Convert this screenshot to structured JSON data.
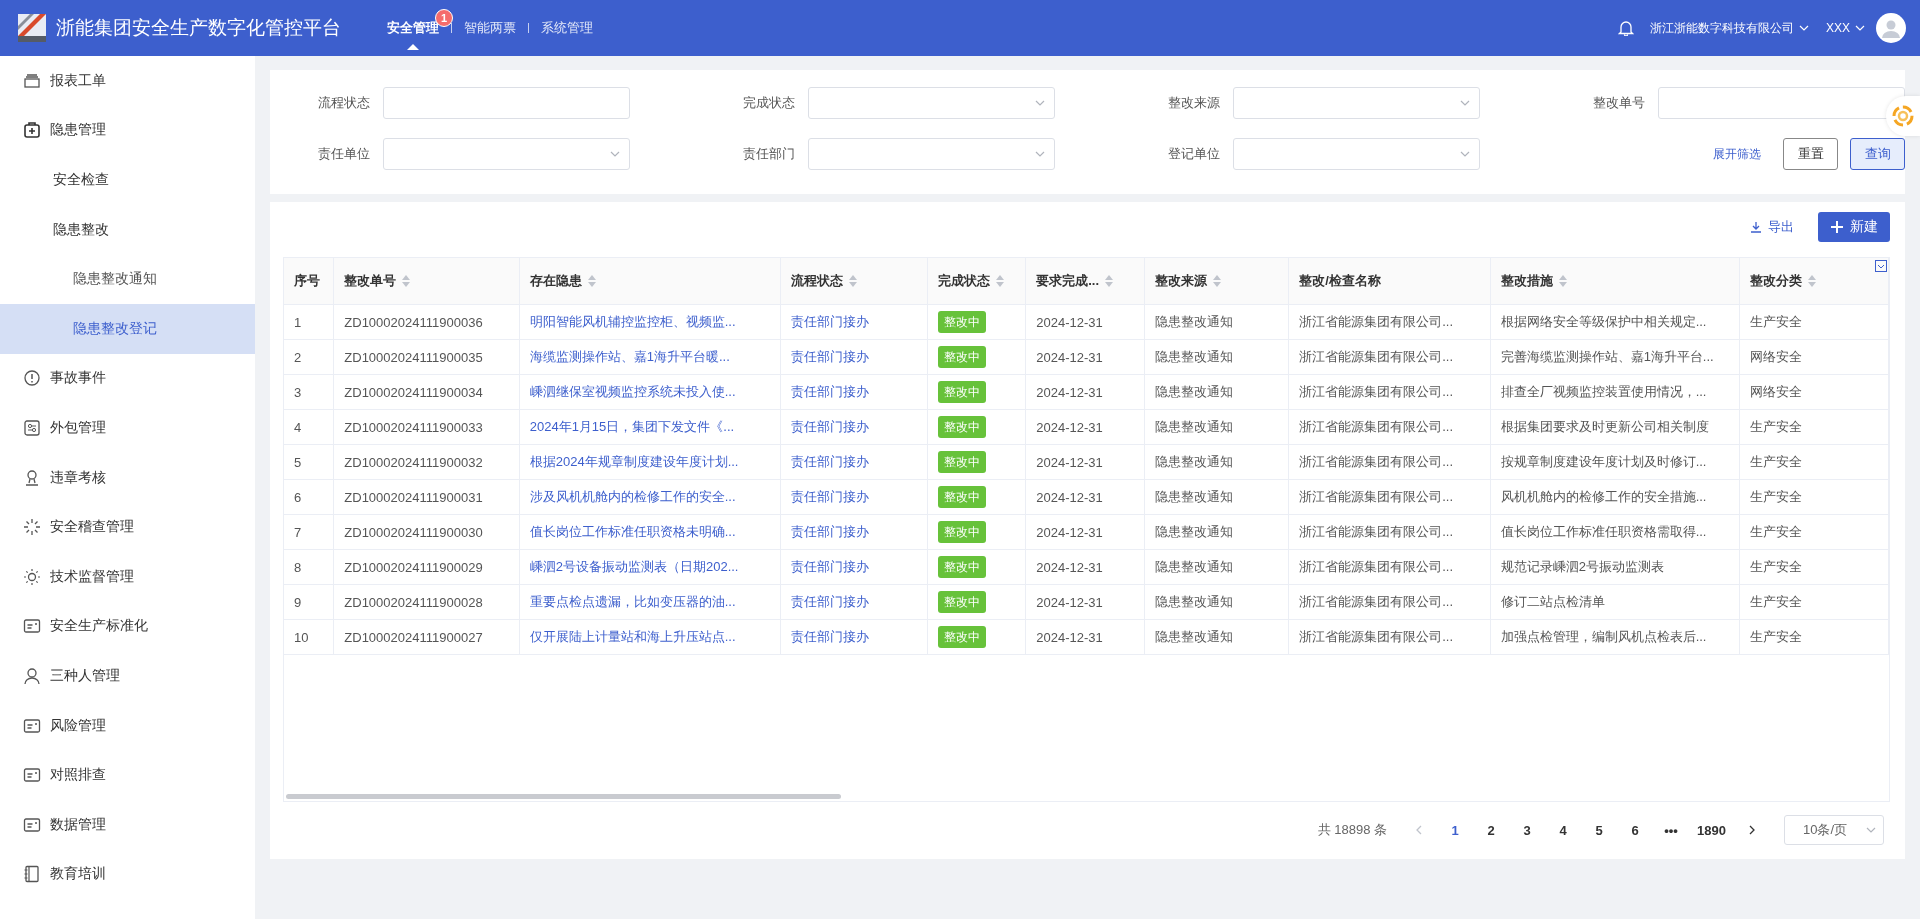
{
  "header": {
    "title": "浙能集团安全生产数字化管控平台",
    "tabs": [
      {
        "label": "安全管理",
        "selected": true,
        "badge": "1"
      },
      {
        "label": "智能两票",
        "selected": false
      },
      {
        "label": "系统管理",
        "selected": false
      }
    ],
    "company": "浙江浙能数字科技有限公司",
    "user": "XXX"
  },
  "sidebar": {
    "items": [
      {
        "label": "报表工单",
        "selected": false
      },
      {
        "label": "隐患管理",
        "selected": false,
        "children": [
          {
            "label": "安全检查",
            "selected": false
          },
          {
            "label": "隐患整改",
            "selected": false,
            "children": [
              {
                "label": "隐患整改通知",
                "selected": false
              },
              {
                "label": "隐患整改登记",
                "selected": true
              }
            ]
          }
        ]
      },
      {
        "label": "事故事件",
        "selected": false
      },
      {
        "label": "外包管理",
        "selected": false
      },
      {
        "label": "违章考核",
        "selected": false
      },
      {
        "label": "安全稽查管理",
        "selected": false
      },
      {
        "label": "技术监督管理",
        "selected": false
      },
      {
        "label": "安全生产标准化",
        "selected": false
      },
      {
        "label": "三种人管理",
        "selected": false
      },
      {
        "label": "风险管理",
        "selected": false
      },
      {
        "label": "对照排查",
        "selected": false
      },
      {
        "label": "数据管理",
        "selected": false
      },
      {
        "label": "教育培训",
        "selected": false
      }
    ]
  },
  "filters": [
    {
      "label": "流程状态",
      "kind": "text"
    },
    {
      "label": "完成状态",
      "kind": "select"
    },
    {
      "label": "整改来源",
      "kind": "select"
    },
    {
      "label": "整改单号",
      "kind": "text"
    },
    {
      "label": "责任单位",
      "kind": "select"
    },
    {
      "label": "责任部门",
      "kind": "select"
    },
    {
      "label": "登记单位",
      "kind": "select"
    }
  ],
  "filter_actions": [
    {
      "label": "展开筛选",
      "kind": "link"
    },
    {
      "label": "重置",
      "kind": "default"
    },
    {
      "label": "查询",
      "kind": "primary"
    }
  ],
  "toolbar": {
    "export": "导出",
    "create": "新建"
  },
  "table": {
    "columns": [
      {
        "label": "序号",
        "sortable": false,
        "kind": "text"
      },
      {
        "label": "整改单号",
        "sortable": true,
        "kind": "text"
      },
      {
        "label": "存在隐患",
        "sortable": true,
        "kind": "link"
      },
      {
        "label": "流程状态",
        "sortable": true,
        "kind": "link"
      },
      {
        "label": "完成状态",
        "sortable": true,
        "kind": "tag"
      },
      {
        "label": "要求完成...",
        "sortable": true,
        "kind": "text"
      },
      {
        "label": "整改来源",
        "sortable": true,
        "kind": "text"
      },
      {
        "label": "整改/检查名称",
        "sortable": false,
        "kind": "text"
      },
      {
        "label": "整改措施",
        "sortable": true,
        "kind": "text"
      },
      {
        "label": "整改分类",
        "sortable": true,
        "kind": "text"
      }
    ],
    "rows": [
      [
        "1",
        "ZD10002024111900036",
        "明阳智能风机辅控监控柜、视频监...",
        "责任部门接办",
        "整改中",
        "2024-12-31",
        "隐患整改通知",
        "浙江省能源集团有限公司...",
        "根据网络安全等级保护中相关规定...",
        "生产安全"
      ],
      [
        "2",
        "ZD10002024111900035",
        "海缆监测操作站、嘉1海升平台暖...",
        "责任部门接办",
        "整改中",
        "2024-12-31",
        "隐患整改通知",
        "浙江省能源集团有限公司...",
        "完善海缆监测操作站、嘉1海升平台...",
        "网络安全"
      ],
      [
        "3",
        "ZD10002024111900034",
        "嵊泗继保室视频监控系统未投入使...",
        "责任部门接办",
        "整改中",
        "2024-12-31",
        "隐患整改通知",
        "浙江省能源集团有限公司...",
        "排查全厂视频监控装置使用情况，...",
        "网络安全"
      ],
      [
        "4",
        "ZD10002024111900033",
        "2024年1月15日，集团下发文件《...",
        "责任部门接办",
        "整改中",
        "2024-12-31",
        "隐患整改通知",
        "浙江省能源集团有限公司...",
        "根据集团要求及时更新公司相关制度",
        "生产安全"
      ],
      [
        "5",
        "ZD10002024111900032",
        "根据2024年规章制度建设年度计划...",
        "责任部门接办",
        "整改中",
        "2024-12-31",
        "隐患整改通知",
        "浙江省能源集团有限公司...",
        "按规章制度建设年度计划及时修订...",
        "生产安全"
      ],
      [
        "6",
        "ZD10002024111900031",
        "涉及风机机舱内的检修工作的安全...",
        "责任部门接办",
        "整改中",
        "2024-12-31",
        "隐患整改通知",
        "浙江省能源集团有限公司...",
        "风机机舱内的检修工作的安全措施...",
        "生产安全"
      ],
      [
        "7",
        "ZD10002024111900030",
        "值长岗位工作标准任职资格未明确...",
        "责任部门接办",
        "整改中",
        "2024-12-31",
        "隐患整改通知",
        "浙江省能源集团有限公司...",
        "值长岗位工作标准任职资格需取得...",
        "生产安全"
      ],
      [
        "8",
        "ZD10002024111900029",
        "嵊泗2号设备振动监测表（日期202...",
        "责任部门接办",
        "整改中",
        "2024-12-31",
        "隐患整改通知",
        "浙江省能源集团有限公司...",
        "规范记录嵊泗2号振动监测表",
        "生产安全"
      ],
      [
        "9",
        "ZD10002024111900028",
        "重要点检点遗漏，比如变压器的油...",
        "责任部门接办",
        "整改中",
        "2024-12-31",
        "隐患整改通知",
        "浙江省能源集团有限公司...",
        "修订二站点检清单",
        "生产安全"
      ],
      [
        "10",
        "ZD10002024111900027",
        "仅开展陆上计量站和海上升压站点...",
        "责任部门接办",
        "整改中",
        "2024-12-31",
        "隐患整改通知",
        "浙江省能源集团有限公司...",
        "加强点检管理，编制风机点检表后...",
        "生产安全"
      ]
    ]
  },
  "pagination": {
    "total": "共 18898 条",
    "prev": {
      "disabled": true
    },
    "next": {
      "disabled": false
    },
    "pages": [
      {
        "label": "1",
        "selected": true
      },
      {
        "label": "2",
        "selected": false
      },
      {
        "label": "3",
        "selected": false
      },
      {
        "label": "4",
        "selected": false
      },
      {
        "label": "5",
        "selected": false
      },
      {
        "label": "6",
        "selected": false
      },
      {
        "label": "•••",
        "selected": false
      },
      {
        "label": "1890",
        "selected": false
      }
    ],
    "page_size": "10条/页"
  }
}
